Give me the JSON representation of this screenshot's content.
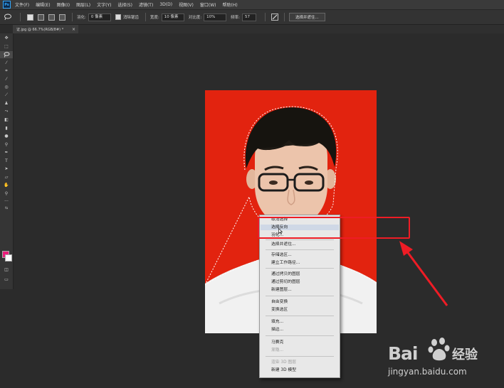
{
  "app": {
    "logo": "Ps"
  },
  "menubar": {
    "items": [
      "文件(F)",
      "编辑(E)",
      "图像(I)",
      "图层(L)",
      "文字(Y)",
      "选择(S)",
      "滤镜(T)",
      "3D(D)",
      "视图(V)",
      "窗口(W)",
      "帮助(H)"
    ]
  },
  "options": {
    "feather_label": "羽化:",
    "feather_value": "0 像素",
    "antialias_label": "消除锯齿",
    "width_label": "宽度:",
    "width_value": "10 像素",
    "contrast_label": "对比度:",
    "contrast_value": "10%",
    "frequency_label": "频率:",
    "frequency_value": "57",
    "select_mask_button": "选择并遮住..."
  },
  "document": {
    "tab_title": "证.jpg @ 66.7%(RGB/8#) *",
    "close_glyph": "×"
  },
  "context_menu": {
    "items": [
      {
        "label": "取消选择",
        "state": "normal"
      },
      {
        "label": "选择反向",
        "state": "hover"
      },
      {
        "label": "羽化...",
        "state": "normal"
      },
      {
        "label": "选择并遮住...",
        "state": "normal"
      },
      {
        "label": "存储选区...",
        "state": "normal"
      },
      {
        "label": "建立工作路径...",
        "state": "normal"
      },
      {
        "label": "通过拷贝的图层",
        "state": "normal"
      },
      {
        "label": "通过剪切的图层",
        "state": "normal"
      },
      {
        "label": "新建图层...",
        "state": "normal"
      },
      {
        "label": "自由变换",
        "state": "normal"
      },
      {
        "label": "变换选区",
        "state": "normal"
      },
      {
        "label": "填充...",
        "state": "normal"
      },
      {
        "label": "描边...",
        "state": "normal"
      },
      {
        "label": "马赛克",
        "state": "normal"
      },
      {
        "label": "渐隐...",
        "state": "disabled"
      },
      {
        "label": "渲染 3D 图层",
        "state": "disabled"
      },
      {
        "label": "新建 3D 模型",
        "state": "normal"
      }
    ]
  },
  "watermark": {
    "brand": "Bai",
    "brand_cn": "经验",
    "url": "jingyan.baidu.com"
  },
  "colors": {
    "photo_background": "#e2230f",
    "foreground_swatch": "#e91e7a",
    "background_swatch": "#ffffff",
    "annotation": "#ee1c25"
  },
  "icons": {
    "toolbar": [
      "move-icon",
      "marquee-icon",
      "lasso-icon",
      "magic-wand-icon",
      "crop-icon",
      "eyedropper-icon",
      "healing-brush-icon",
      "brush-icon",
      "clone-stamp-icon",
      "history-brush-icon",
      "eraser-icon",
      "gradient-icon",
      "blur-icon",
      "dodge-icon",
      "pen-icon",
      "type-icon",
      "path-selection-icon",
      "shape-icon",
      "hand-icon",
      "zoom-icon",
      "more-icon"
    ]
  }
}
